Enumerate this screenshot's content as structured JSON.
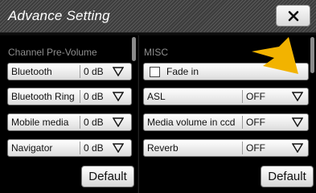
{
  "window": {
    "title": "Advance Setting",
    "close_icon": "close-x-icon"
  },
  "left_panel": {
    "section_title": "Channel Pre-Volume",
    "rows": [
      {
        "label": "Bluetooth",
        "value": "0 dB"
      },
      {
        "label": "Bluetooth Ring",
        "value": "0 dB"
      },
      {
        "label": "Mobile media",
        "value": "0 dB"
      },
      {
        "label": "Navigator",
        "value": "0 dB"
      }
    ],
    "default_label": "Default"
  },
  "right_panel": {
    "section_title": "MISC",
    "checkbox": {
      "label": "Fade in",
      "checked": false
    },
    "rows": [
      {
        "label": "ASL",
        "value": "OFF"
      },
      {
        "label": "Media volume in ccd",
        "value": "OFF"
      },
      {
        "label": "Reverb",
        "value": "OFF"
      }
    ],
    "default_label": "Default"
  },
  "colors": {
    "pointer": "#f0b400",
    "section_title": "#8e8e8e"
  }
}
